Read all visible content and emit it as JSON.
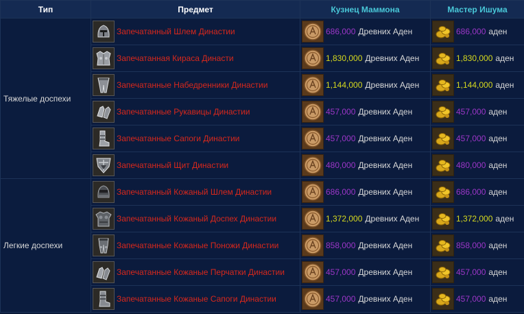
{
  "headers": {
    "type": "Тип",
    "item": "Предмет",
    "smith": "Кузнец Маммона",
    "master": "Мастер Ишума"
  },
  "colors": {
    "item_name": "#d8281c",
    "price_purple": "#9c36c8",
    "price_yellow": "#d7da1e",
    "header_cyan": "#49c8d8"
  },
  "groups": [
    {
      "type": "Тяжелые доспехи",
      "rows": [
        {
          "icon": "helmet-icon",
          "name": "Запечатанный Шлем Династии",
          "smith_price": "686,000",
          "smith_currency": "Древних Аден",
          "smith_color": "purple",
          "master_price": "686,000",
          "master_currency": "аден",
          "master_color": "purple"
        },
        {
          "icon": "breastplate-icon",
          "name": "Запечатанная Кираса Династи",
          "smith_price": "1,830,000",
          "smith_currency": "Древних Аден",
          "smith_color": "yellow",
          "master_price": "1,830,000",
          "master_currency": "аден",
          "master_color": "yellow"
        },
        {
          "icon": "leg-armor-icon",
          "name": "Запечатанные Набедренники Династии",
          "smith_price": "1,144,000",
          "smith_currency": "Древних Аден",
          "smith_color": "yellow",
          "master_price": "1,144,000",
          "master_currency": "аден",
          "master_color": "yellow"
        },
        {
          "icon": "gauntlets-icon",
          "name": "Запечатанные Рукавицы Династии",
          "smith_price": "457,000",
          "smith_currency": "Древних Аден",
          "smith_color": "purple",
          "master_price": "457,000",
          "master_currency": "аден",
          "master_color": "purple"
        },
        {
          "icon": "boots-icon",
          "name": "Запечатанные Сапоги Династии",
          "smith_price": "457,000",
          "smith_currency": "Древних Аден",
          "smith_color": "purple",
          "master_price": "457,000",
          "master_currency": "аден",
          "master_color": "purple"
        },
        {
          "icon": "shield-icon",
          "name": "Запечатанный Щит Династии",
          "smith_price": "480,000",
          "smith_currency": "Древних Аден",
          "smith_color": "purple",
          "master_price": "480,000",
          "master_currency": "аден",
          "master_color": "purple"
        }
      ]
    },
    {
      "type": "Легкие доспехи",
      "rows": [
        {
          "icon": "leather-helmet-icon",
          "name": "Запечатанный Кожаный Шлем Династии",
          "smith_price": "686,000",
          "smith_currency": "Древних Аден",
          "smith_color": "purple",
          "master_price": "686,000",
          "master_currency": "аден",
          "master_color": "purple"
        },
        {
          "icon": "leather-armor-icon",
          "name": "Запечатанный Кожаный Доспех Династии",
          "smith_price": "1,372,000",
          "smith_currency": "Древних Аден",
          "smith_color": "yellow",
          "master_price": "1,372,000",
          "master_currency": "аден",
          "master_color": "yellow"
        },
        {
          "icon": "leather-leggings-icon",
          "name": "Запечатанные Кожаные Поножи Династии",
          "smith_price": "858,000",
          "smith_currency": "Древних Аден",
          "smith_color": "purple",
          "master_price": "858,000",
          "master_currency": "аден",
          "master_color": "purple"
        },
        {
          "icon": "leather-gloves-icon",
          "name": "Запечатанные Кожаные Перчатки Династии",
          "smith_price": "457,000",
          "smith_currency": "Древних Аден",
          "smith_color": "purple",
          "master_price": "457,000",
          "master_currency": "аден",
          "master_color": "purple"
        },
        {
          "icon": "leather-boots-icon",
          "name": "Запечатанные Кожаные Сапоги Династии",
          "smith_price": "457,000",
          "smith_currency": "Древних Аден",
          "smith_color": "purple",
          "master_price": "457,000",
          "master_currency": "аден",
          "master_color": "purple"
        }
      ]
    }
  ]
}
